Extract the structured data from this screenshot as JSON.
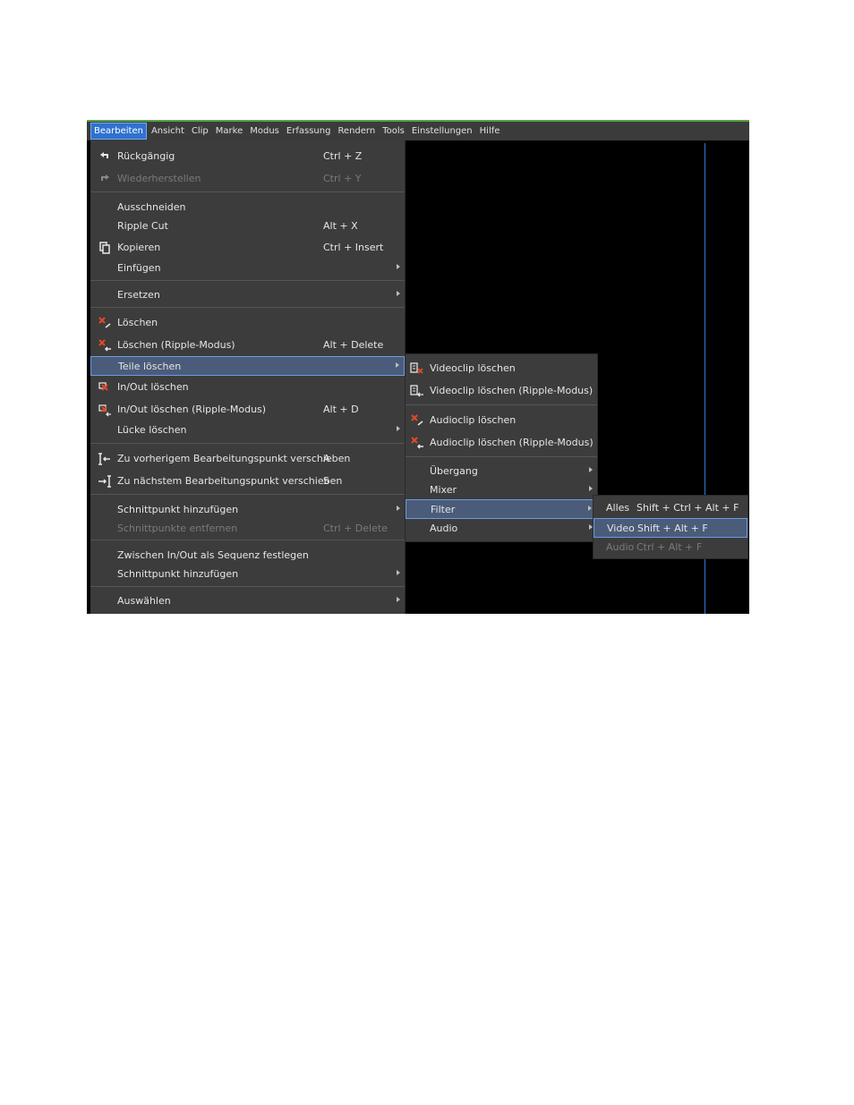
{
  "menubar": {
    "items": [
      "Bearbeiten",
      "Ansicht",
      "Clip",
      "Marke",
      "Modus",
      "Erfassung",
      "Rendern",
      "Tools",
      "Einstellungen",
      "Hilfe"
    ]
  },
  "edit_menu": {
    "undo": {
      "label": "Rückgängig",
      "shortcut": "Ctrl + Z"
    },
    "redo": {
      "label": "Wiederherstellen",
      "shortcut": "Ctrl + Y"
    },
    "cut": {
      "label": "Ausschneiden"
    },
    "ripple_cut": {
      "label": "Ripple Cut",
      "shortcut": "Alt + X"
    },
    "copy": {
      "label": "Kopieren",
      "shortcut": "Ctrl + Insert"
    },
    "paste": {
      "label": "Einfügen"
    },
    "replace": {
      "label": "Ersetzen"
    },
    "delete": {
      "label": "Löschen"
    },
    "delete_ripple": {
      "label": "Löschen (Ripple-Modus)",
      "shortcut": "Alt + Delete"
    },
    "delete_parts": {
      "label": "Teile löschen"
    },
    "inout_delete": {
      "label": "In/Out löschen"
    },
    "inout_delete_ripple": {
      "label": "In/Out löschen (Ripple-Modus)",
      "shortcut": "Alt + D"
    },
    "gap_delete": {
      "label": "Lücke löschen"
    },
    "prev_edit": {
      "label": "Zu vorherigem Bearbeitungspunkt verschieben",
      "shortcut": "A"
    },
    "next_edit": {
      "label": "Zu nächstem Bearbeitungspunkt verschieben",
      "shortcut": "S"
    },
    "add_cut": {
      "label": "Schnittpunkt hinzufügen"
    },
    "remove_cuts": {
      "label": "Schnittpunkte entfernen",
      "shortcut": "Ctrl + Delete"
    },
    "set_sequence": {
      "label": "Zwischen In/Out als Sequenz festlegen"
    },
    "add_cut2": {
      "label": "Schnittpunkt hinzufügen"
    },
    "select": {
      "label": "Auswählen"
    }
  },
  "parts_submenu": {
    "video_delete": {
      "label": "Videoclip löschen"
    },
    "video_delete_ripple": {
      "label": "Videoclip löschen (Ripple-Modus)"
    },
    "audio_delete": {
      "label": "Audioclip löschen"
    },
    "audio_delete_ripple": {
      "label": "Audioclip löschen (Ripple-Modus)"
    },
    "transition": {
      "label": "Übergang"
    },
    "mixer": {
      "label": "Mixer"
    },
    "filter": {
      "label": "Filter"
    },
    "audio": {
      "label": "Audio"
    }
  },
  "filter_submenu": {
    "all": {
      "label": "Alles",
      "shortcut": "Shift + Ctrl + Alt + F"
    },
    "video": {
      "label": "Video",
      "shortcut": "Shift + Alt + F"
    },
    "audio": {
      "label": "Audio",
      "shortcut": "Ctrl + Alt + F"
    }
  }
}
